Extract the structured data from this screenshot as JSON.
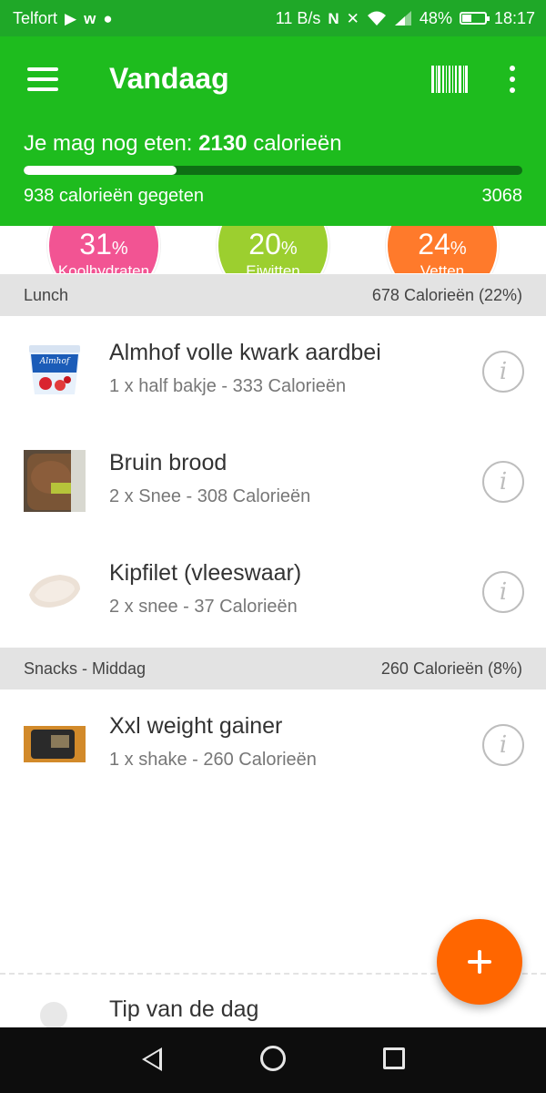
{
  "status_bar": {
    "carrier": "Telfort",
    "speed": "11 B/s",
    "battery": "48%",
    "battery_level": 0.48,
    "time": "18:17"
  },
  "header": {
    "title": "Vandaag",
    "remaining_prefix": "Je mag nog eten: ",
    "remaining_value": "2130",
    "remaining_suffix": " calorieën",
    "eaten": "938 calorieën gegeten",
    "goal": "3068",
    "progress": 0.306,
    "colors": {
      "header": "#1ebc1e",
      "status_bar": "#1fa828",
      "progress_track": "#0e6f14"
    }
  },
  "macros": [
    {
      "value": "31",
      "unit": "%",
      "label": "Koolhydraten",
      "color": "#f25493"
    },
    {
      "value": "20",
      "unit": "%",
      "label": "Eiwitten",
      "color": "#9ccf2f"
    },
    {
      "value": "24",
      "unit": "%",
      "label": "Vetten",
      "color": "#ff7a2b"
    }
  ],
  "meals": [
    {
      "name": "Lunch",
      "summary": "678 Calorieën (22%)",
      "items": [
        {
          "name": "Almhof volle kwark aardbei",
          "detail": "1 x half bakje - 333 Calorieën",
          "thumb": "yogurt-cup",
          "thumb_label": "Almhof"
        },
        {
          "name": "Bruin brood",
          "detail": "2 x Snee - 308 Calorieën",
          "thumb": "bread-bag"
        },
        {
          "name": "Kipfilet (vleeswaar)",
          "detail": "2 x snee - 37 Calorieën",
          "thumb": "sliced-meat"
        }
      ]
    },
    {
      "name": "Snacks - Middag",
      "summary": "260 Calorieën (8%)",
      "items": [
        {
          "name": "Xxl weight gainer",
          "detail": "1 x shake - 260 Calorieën",
          "thumb": "supplement-tub"
        }
      ]
    }
  ],
  "tip": {
    "title": "Tip van de dag",
    "icon": "lightbulb-icon"
  },
  "fab": {
    "icon": "plus-icon",
    "color": "#ff6600"
  }
}
